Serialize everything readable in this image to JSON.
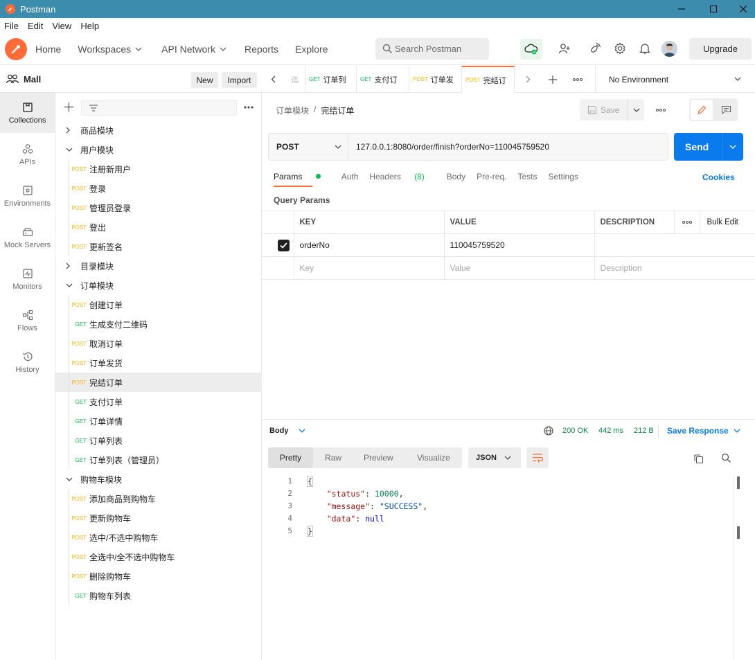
{
  "window": {
    "title": "Postman"
  },
  "menu": [
    "File",
    "Edit",
    "View",
    "Help"
  ],
  "header": {
    "nav": {
      "home": "Home",
      "workspaces": "Workspaces",
      "api_network": "API Network",
      "reports": "Reports",
      "explore": "Explore"
    },
    "search_placeholder": "Search Postman",
    "upgrade": "Upgrade"
  },
  "workspace": {
    "name": "Mall",
    "new": "New",
    "import": "Import"
  },
  "sidebar_icons": [
    {
      "label": "Collections",
      "icon": "collections-icon",
      "active": true
    },
    {
      "label": "APIs",
      "icon": "apis-icon"
    },
    {
      "label": "Environments",
      "icon": "environments-icon"
    },
    {
      "label": "Mock Servers",
      "icon": "mock-servers-icon"
    },
    {
      "label": "Monitors",
      "icon": "monitors-icon"
    },
    {
      "label": "Flows",
      "icon": "flows-icon"
    },
    {
      "label": "History",
      "icon": "history-icon"
    }
  ],
  "tree": [
    {
      "type": "folder",
      "name": "商品模块",
      "open": false
    },
    {
      "type": "folder",
      "name": "用户模块",
      "open": true
    },
    {
      "type": "request",
      "method": "POST",
      "name": "注册新用户"
    },
    {
      "type": "request",
      "method": "POST",
      "name": "登录"
    },
    {
      "type": "request",
      "method": "POST",
      "name": "管理员登录"
    },
    {
      "type": "request",
      "method": "POST",
      "name": "登出"
    },
    {
      "type": "request",
      "method": "POST",
      "name": "更新签名"
    },
    {
      "type": "folder",
      "name": "目录模块",
      "open": false
    },
    {
      "type": "folder",
      "name": "订单模块",
      "open": true
    },
    {
      "type": "request",
      "method": "POST",
      "name": "创建订单"
    },
    {
      "type": "request",
      "method": "GET",
      "name": "生成支付二维码"
    },
    {
      "type": "request",
      "method": "POST",
      "name": "取消订单"
    },
    {
      "type": "request",
      "method": "POST",
      "name": "订单发货"
    },
    {
      "type": "request",
      "method": "POST",
      "name": "完结订单",
      "selected": true
    },
    {
      "type": "request",
      "method": "GET",
      "name": "支付订单"
    },
    {
      "type": "request",
      "method": "GET",
      "name": "订单详情"
    },
    {
      "type": "request",
      "method": "GET",
      "name": "订单列表"
    },
    {
      "type": "request",
      "method": "GET",
      "name": "订单列表（管理员）"
    },
    {
      "type": "folder",
      "name": "购物车模块",
      "open": true
    },
    {
      "type": "request",
      "method": "POST",
      "name": "添加商品到购物车"
    },
    {
      "type": "request",
      "method": "POST",
      "name": "更新购物车"
    },
    {
      "type": "request",
      "method": "POST",
      "name": "选中/不选中购物车"
    },
    {
      "type": "request",
      "method": "POST",
      "name": "全选中/全不选中购物车"
    },
    {
      "type": "request",
      "method": "POST",
      "name": "删除购物车"
    },
    {
      "type": "request",
      "method": "GET",
      "name": "购物车列表"
    }
  ],
  "tabs": [
    {
      "method": "",
      "name": "迄"
    },
    {
      "method": "GET",
      "name": "订单列"
    },
    {
      "method": "GET",
      "name": "支付订"
    },
    {
      "method": "POST",
      "name": "订单发"
    },
    {
      "method": "POST",
      "name": "完结订",
      "active": true
    }
  ],
  "environment": "No Environment",
  "request": {
    "breadcrumb": [
      "订单模块",
      "完结订单"
    ],
    "save": "Save",
    "method": "POST",
    "url": "127.0.0.1:8080/order/finish?orderNo=110045759520",
    "send": "Send",
    "tabs": {
      "params": "Params",
      "auth": "Auth",
      "headers": "Headers",
      "headers_count": "(8)",
      "body": "Body",
      "prereq": "Pre-req.",
      "tests": "Tests",
      "settings": "Settings"
    },
    "cookies": "Cookies",
    "query_params_title": "Query Params",
    "columns": {
      "key": "KEY",
      "value": "VALUE",
      "description": "DESCRIPTION",
      "bulk_edit": "Bulk Edit"
    },
    "params": [
      {
        "key": "orderNo",
        "value": "110045759520",
        "description": "",
        "checked": true
      }
    ],
    "placeholders": {
      "key": "Key",
      "value": "Value",
      "description": "Description"
    }
  },
  "response": {
    "label": "Body",
    "status": "200 OK",
    "time": "442 ms",
    "size": "212 B",
    "save_response": "Save Response",
    "views": [
      "Pretty",
      "Raw",
      "Preview",
      "Visualize"
    ],
    "format": "JSON",
    "lines": [
      {
        "n": "1",
        "text": "{"
      },
      {
        "n": "2",
        "key": "\"status\"",
        "val": "10000",
        "vt": "n",
        "tail": ","
      },
      {
        "n": "3",
        "key": "\"message\"",
        "val": "\"SUCCESS\"",
        "vt": "s",
        "tail": ","
      },
      {
        "n": "4",
        "key": "\"data\"",
        "val": "null",
        "vt": "nl",
        "tail": ""
      },
      {
        "n": "5",
        "text": "}"
      }
    ]
  },
  "colors": {
    "accent": "#ff6c37",
    "send": "#097bed",
    "post": "#ffb400",
    "get": "#0cbb52",
    "titlebar": "#3c8dad"
  }
}
